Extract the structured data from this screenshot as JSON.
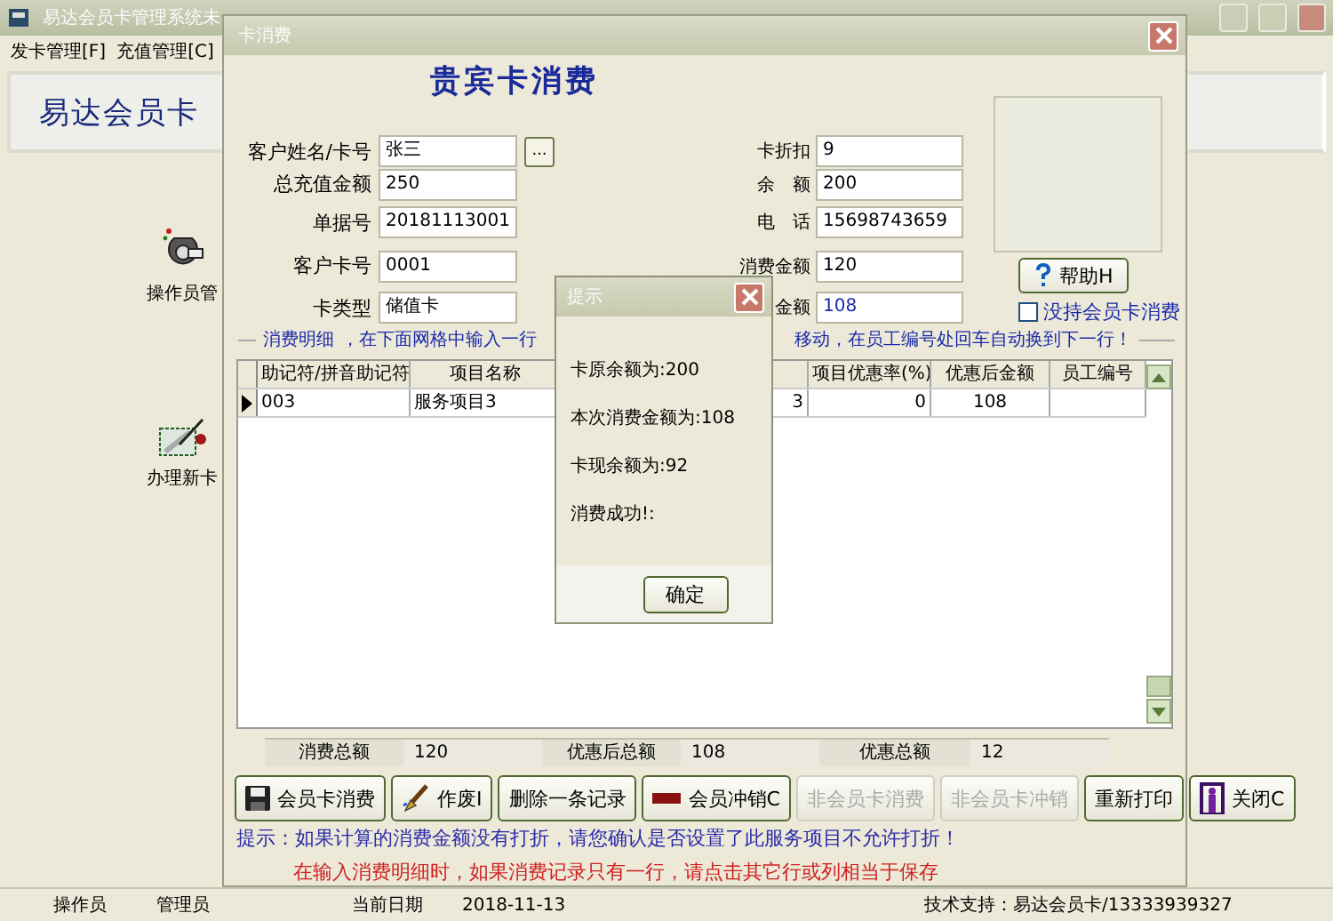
{
  "main_window": {
    "title": "易达会员卡管理系统未",
    "menu": [
      {
        "label": "发卡管理[F]"
      },
      {
        "label": "充值管理[C]"
      }
    ],
    "banner": "易达会员卡",
    "sidebar": [
      {
        "label": "操作员管"
      },
      {
        "label": "办理新卡"
      }
    ],
    "status_bar": [
      {
        "text": "操作员"
      },
      {
        "text": "管理员"
      },
      {
        "text": "当前日期"
      },
      {
        "text": "2018-11-13"
      },
      {
        "text": "技术支持：易达会员卡/13333939327"
      }
    ]
  },
  "dialog": {
    "title": "卡消费",
    "heading": "贵宾卡消费",
    "left_fields": [
      {
        "label": "客户姓名/卡号",
        "value": "张三",
        "browse": "..."
      },
      {
        "label": "总充值金额",
        "value": "250"
      },
      {
        "label": "单据号",
        "value": "20181113001"
      },
      {
        "label": "客户卡号",
        "value": "0001"
      },
      {
        "label": "卡类型",
        "value": "储值卡"
      }
    ],
    "right_fields": [
      {
        "label": "卡折扣",
        "value": "9"
      },
      {
        "label": "余　额",
        "value": "200"
      },
      {
        "label": "电　话",
        "value": "15698743659"
      },
      {
        "label": "消费金额",
        "value": "120"
      },
      {
        "label": "金额",
        "value": "108",
        "highlight": true
      }
    ],
    "help_button": "帮助H",
    "no_card_checkbox": {
      "label": "没持会员卡消费",
      "checked": false
    },
    "detail_legend": {
      "title": "消费明细",
      "hint_start": "，在下面网格中输入一行",
      "hint_end": "移动，在员工编号处回车自动换到下一行！"
    },
    "grid": {
      "columns": [
        {
          "label": "助记符/拼音助记符"
        },
        {
          "label": "项目名称"
        },
        {},
        {
          "label": "项目优惠率(%)"
        },
        {
          "label": "优惠后金额"
        },
        {
          "label": "员工编号"
        }
      ],
      "rows": [
        {
          "current": true,
          "cells": [
            "003",
            "服务项目3",
            "3",
            "0",
            "108"
          ]
        }
      ]
    },
    "totals": [
      {
        "label": "消费总额",
        "value": "120"
      },
      {
        "label": "优惠后总额",
        "value": "108"
      },
      {
        "label": "优惠总额",
        "value": "12"
      }
    ],
    "buttons": [
      {
        "label": "会员卡消费",
        "disabled": false
      },
      {
        "label": "作废I",
        "disabled": false
      },
      {
        "label": "删除一条记录",
        "disabled": false
      },
      {
        "label": "会员冲销C",
        "disabled": false
      },
      {
        "label": "非会员卡消费",
        "disabled": true
      },
      {
        "label": "非会员卡冲销",
        "disabled": true
      },
      {
        "label": "重新打印",
        "disabled": false
      },
      {
        "label": "关闭C",
        "disabled": false
      }
    ],
    "tips": [
      {
        "kind": "info",
        "text": "提示：如果计算的消费金额没有打折，请您确认是否设置了此服务项目不允许打折！"
      },
      {
        "kind": "warning",
        "text": "在输入消费明细时，如果消费记录只有一行，请点击其它行或列相当于保存"
      }
    ]
  },
  "popup": {
    "title": "提示",
    "lines": [
      "卡原余额为:200",
      "本次消费金额为:108",
      "卡现余额为:92",
      "消费成功!:"
    ],
    "button": "确定"
  }
}
